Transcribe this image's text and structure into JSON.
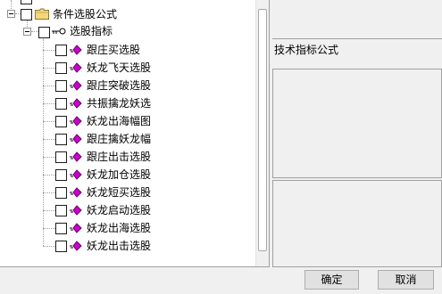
{
  "tree": {
    "root_label": "条件选股公式",
    "group_label": "选股指标",
    "items": [
      {
        "label": "跟庄买选股"
      },
      {
        "label": "妖龙飞天选股"
      },
      {
        "label": "跟庄突破选股"
      },
      {
        "label": "共振擒龙妖选"
      },
      {
        "label": "妖龙出海幅图"
      },
      {
        "label": "跟庄擒妖龙幅"
      },
      {
        "label": "跟庄出击选股"
      },
      {
        "label": "妖龙加仓选股"
      },
      {
        "label": "妖龙短买选股"
      },
      {
        "label": "妖龙启动选股"
      },
      {
        "label": "妖龙出海选股"
      },
      {
        "label": "妖龙出击选股"
      }
    ]
  },
  "right_panel": {
    "title": "技术指标公式"
  },
  "buttons": {
    "ok": "确定",
    "cancel": "取消"
  },
  "colors": {
    "leaf_icon": "#cc00cc",
    "folder": "#f5d67a"
  }
}
